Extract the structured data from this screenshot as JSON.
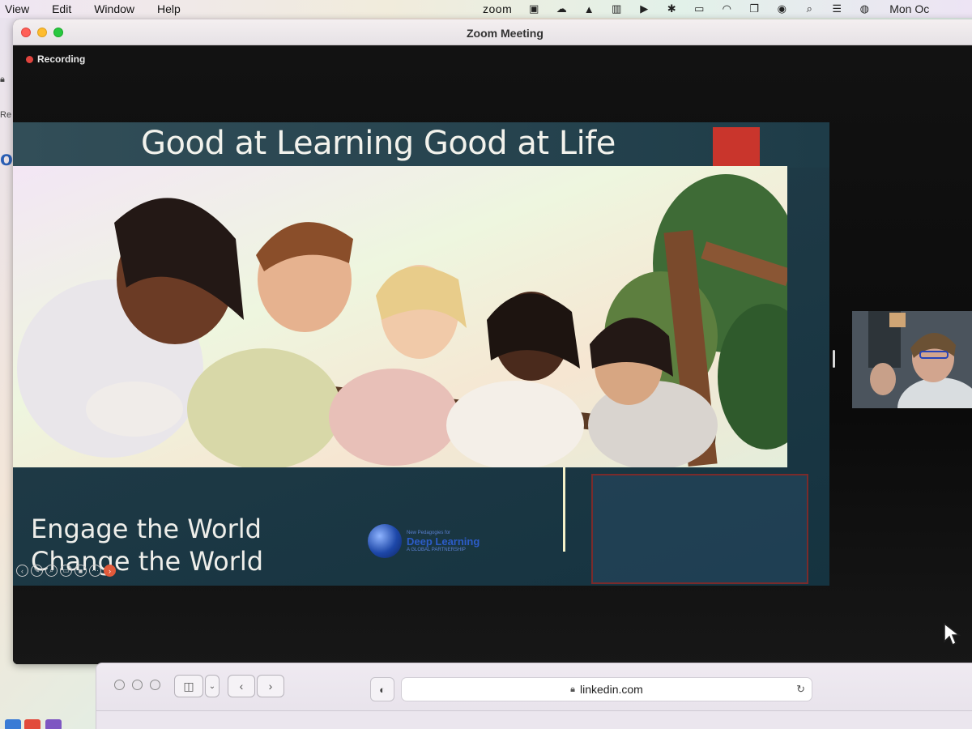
{
  "menubar": {
    "items": [
      "View",
      "Edit",
      "Window",
      "Help"
    ],
    "zoom_label": "zoom",
    "clock": "Mon Oc"
  },
  "window": {
    "title": "Zoom Meeting",
    "recording_label": "Recording"
  },
  "slide": {
    "title": "Good at Learning Good at Life",
    "tagline_line1": "Engage the World",
    "tagline_line2": "Change the World",
    "logo_small_top": "New Pedagogies for",
    "logo_main": "Deep Learning",
    "logo_small_bottom": "A GLOBAL PARTNERSHIP"
  },
  "safari": {
    "address": "linkedin.com"
  },
  "colors": {
    "slide_bg": "#1f3a46",
    "title_accent_red": "#c9352c",
    "recording_red": "#e0443e",
    "logo_blue": "#2c5cc8"
  },
  "icons": [
    "recording-dot-icon",
    "lock-icon",
    "reload-icon",
    "shield-icon",
    "back-icon",
    "forward-icon",
    "sidebar-icon",
    "pointer-cursor-icon"
  ]
}
